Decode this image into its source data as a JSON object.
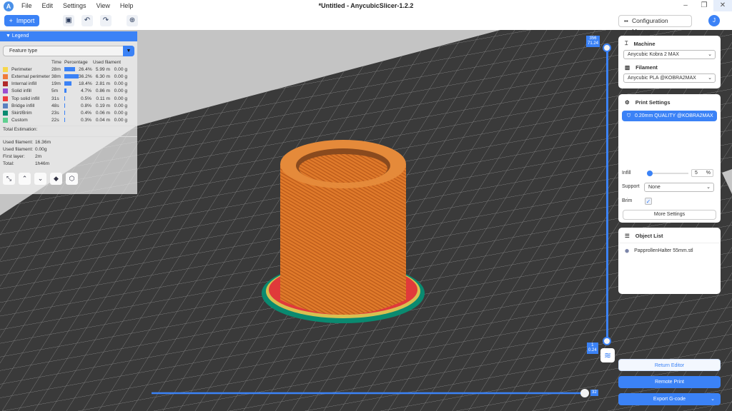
{
  "app": {
    "title": "*Untitled - AnycubicSlicer-1.2.2",
    "logo": "A",
    "menu": [
      "File",
      "Edit",
      "Settings",
      "View",
      "Help"
    ]
  },
  "toolbar": {
    "import_label": "Import",
    "icons": [
      "save-icon",
      "undo-icon",
      "redo-icon",
      "target-icon"
    ],
    "config_label": "Configuration Manage",
    "avatar_initial": "J"
  },
  "legend": {
    "title": "Legend",
    "selector": "Feature type",
    "headers": {
      "time": "Time",
      "percentage": "Percentage",
      "used": "Used filament"
    },
    "rows": [
      {
        "name": "Perimeter",
        "color": "#f7d64a",
        "time": "28m",
        "pct": "26.4%",
        "pct_value": 26.4,
        "length": "5.99 m",
        "weight": "0.00 g"
      },
      {
        "name": "External perimeter",
        "color": "#f07a3a",
        "time": "38m",
        "pct": "36.2%",
        "pct_value": 36.2,
        "length": "6.30 m",
        "weight": "0.00 g"
      },
      {
        "name": "Internal infill",
        "color": "#b02a2a",
        "time": "19m",
        "pct": "18.4%",
        "pct_value": 18.4,
        "length": "2.81 m",
        "weight": "0.00 g"
      },
      {
        "name": "Solid infill",
        "color": "#9b4fd0",
        "time": "5m",
        "pct": "4.7%",
        "pct_value": 4.7,
        "length": "0.86 m",
        "weight": "0.00 g"
      },
      {
        "name": "Top solid infill",
        "color": "#ef3c3c",
        "time": "31s",
        "pct": "0.5%",
        "pct_value": 0.5,
        "length": "0.11 m",
        "weight": "0.00 g"
      },
      {
        "name": "Bridge infill",
        "color": "#5a80c0",
        "time": "48s",
        "pct": "0.8%",
        "pct_value": 0.8,
        "length": "0.19 m",
        "weight": "0.00 g"
      },
      {
        "name": "Skirt/Brim",
        "color": "#0a8a70",
        "time": "23s",
        "pct": "0.4%",
        "pct_value": 0.4,
        "length": "0.06 m",
        "weight": "0.00 g"
      },
      {
        "name": "Custom",
        "color": "#60d090",
        "time": "22s",
        "pct": "0.3%",
        "pct_value": 0.3,
        "length": "0.04 m",
        "weight": "0.00 g"
      }
    ],
    "total_label": "Total Estimation:",
    "summary": [
      [
        "Used filament:",
        "16.36m"
      ],
      [
        "Used filament:",
        "0.00g"
      ],
      [
        "First layer:",
        "2m"
      ],
      [
        "Total:",
        "1h46m"
      ]
    ]
  },
  "right": {
    "machine_label": "Machine",
    "machine_value": "Anycubic Kobra 2 MAX",
    "filament_label": "Filament",
    "filament_value": "Anycubic PLA @KOBRA2MAX",
    "print_settings_label": "Print Settings",
    "quality": "0.20mm QUALITY @KOBRA2MAX",
    "infill_label": "Infill",
    "infill_value": "5",
    "infill_unit": "%",
    "support_label": "Support",
    "support_value": "None",
    "brim_label": "Brim",
    "brim_checked": true,
    "more_settings": "More Settings",
    "object_list_label": "Object List",
    "objects": [
      "PapprollenHalter 55mm.stl"
    ],
    "return_editor": "Return Editor",
    "remote_print": "Remote Print",
    "export": "Export G-code"
  },
  "sliders": {
    "top_layer": "356",
    "top_height": "71.24",
    "bottom_layer": "1",
    "bottom_height": "0.24",
    "horizontal_value": "32"
  },
  "colors": {
    "accent": "#3b82f6",
    "model": "#e07a2a",
    "bed": "#3a3a3a"
  }
}
